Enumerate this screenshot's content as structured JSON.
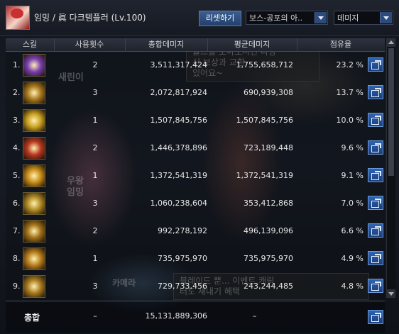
{
  "header": {
    "character": "임밍 / 眞 다크템플러 (Lv.100)",
    "reset_label": "리셋하기",
    "content_select": "보스-공포의 아..",
    "metric_select": "데미지"
  },
  "columns": [
    "스킬",
    "사용횟수",
    "총합데미지",
    "평균데미지",
    "점유율"
  ],
  "rows": [
    {
      "rank": "1.",
      "count": "2",
      "total": "3,511,317,424",
      "average": "1,755,658,712",
      "share": "23.2 %",
      "share_value": 23.2,
      "icon": "skill-icon-purple-burst",
      "icon_color": "#7a3fb0"
    },
    {
      "rank": "2.",
      "count": "3",
      "total": "2,072,817,924",
      "average": "690,939,308",
      "share": "13.7 %",
      "share_value": 13.7,
      "icon": "skill-icon-gold-slash",
      "icon_color": "#a8781e"
    },
    {
      "rank": "3.",
      "count": "1",
      "total": "1,507,845,756",
      "average": "1,507,845,756",
      "share": "10.0 %",
      "share_value": 10.0,
      "icon": "skill-icon-sun-burst",
      "icon_color": "#c9a020"
    },
    {
      "rank": "4.",
      "count": "2",
      "total": "1,446,378,896",
      "average": "723,189,448",
      "share": "9.6 %",
      "share_value": 9.6,
      "icon": "skill-icon-red-cross-slash",
      "icon_color": "#b83820"
    },
    {
      "rank": "5.",
      "count": "1",
      "total": "1,372,541,319",
      "average": "1,372,541,319",
      "share": "9.1 %",
      "share_value": 9.1,
      "icon": "skill-icon-gold-orb",
      "icon_color": "#c88c18"
    },
    {
      "rank": "6.",
      "count": "3",
      "total": "1,060,238,604",
      "average": "353,412,868",
      "share": "7.0 %",
      "share_value": 7.0,
      "icon": "skill-icon-gold-wave",
      "icon_color": "#b08a24"
    },
    {
      "rank": "7.",
      "count": "2",
      "total": "992,278,192",
      "average": "496,139,096",
      "share": "6.6 %",
      "share_value": 6.6,
      "icon": "skill-icon-gold-sparks",
      "icon_color": "#a07018"
    },
    {
      "rank": "8.",
      "count": "1",
      "total": "735,975,970",
      "average": "735,975,970",
      "share": "4.9 %",
      "share_value": 4.9,
      "icon": "skill-icon-gold-flame",
      "icon_color": "#b87e1c"
    },
    {
      "rank": "9.",
      "count": "3",
      "total": "729,733,456",
      "average": "243,244,485",
      "share": "4.8 %",
      "share_value": 4.8,
      "icon": "skill-icon-gold-slash-down",
      "icon_color": "#a87a20"
    }
  ],
  "total": {
    "label": "총합",
    "count": "–",
    "sum": "15,131,889,306",
    "average": "–"
  },
  "background_text": {
    "bubble_top": "들뜨를 모아오시면 다양\n신 보상과 교환\n있어요~",
    "bubble_bottom": "블레이드 뿐... 이벤트 캐릭\n터도 새내기 혜택",
    "name_tag_1": "새린이",
    "name_tag_2": "우왕\n임밍",
    "name_tag_3": "카메라"
  }
}
